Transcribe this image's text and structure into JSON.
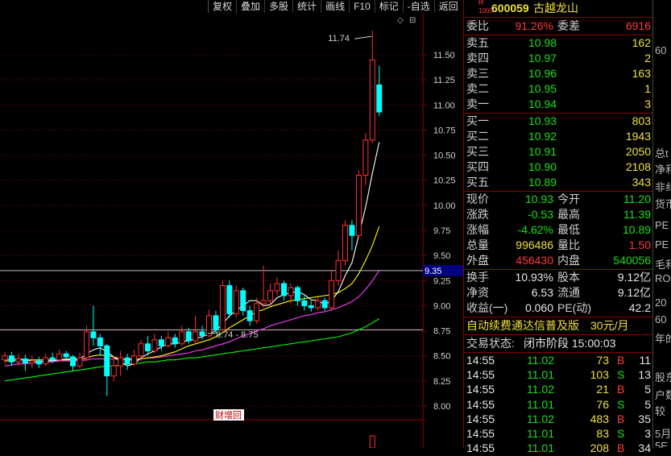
{
  "toolbar": [
    "复权",
    "叠加",
    "多股",
    "统计",
    "画线",
    "F10",
    "标记",
    "-自选",
    "返回"
  ],
  "stock": {
    "r_label": "R",
    "code_small": "1000",
    "code": "600059",
    "name": "古越龙山"
  },
  "weibi": {
    "label": "委比",
    "value": "91.26%",
    "diff_label": "委差",
    "diff": "6916"
  },
  "sells": [
    {
      "label": "卖五",
      "price": "10.98",
      "vol": "162"
    },
    {
      "label": "卖四",
      "price": "10.97",
      "vol": "2"
    },
    {
      "label": "卖三",
      "price": "10.96",
      "vol": "163"
    },
    {
      "label": "卖二",
      "price": "10.95",
      "vol": "1"
    },
    {
      "label": "卖一",
      "price": "10.94",
      "vol": "3"
    }
  ],
  "buys": [
    {
      "label": "买一",
      "price": "10.93",
      "vol": "803"
    },
    {
      "label": "买二",
      "price": "10.92",
      "vol": "1943"
    },
    {
      "label": "买三",
      "price": "10.91",
      "vol": "2050"
    },
    {
      "label": "买四",
      "price": "10.90",
      "vol": "2108"
    },
    {
      "label": "买五",
      "price": "10.89",
      "vol": "343"
    }
  ],
  "quote": [
    {
      "l1": "现价",
      "v1": "10.93",
      "c1": "grn",
      "l2": "今开",
      "v2": "11.20",
      "c2": "grn"
    },
    {
      "l1": "涨跌",
      "v1": "-0.53",
      "c1": "grn",
      "l2": "最高",
      "v2": "11.39",
      "c2": "grn"
    },
    {
      "l1": "涨幅",
      "v1": "-4.62%",
      "c1": "grn",
      "l2": "最低",
      "v2": "10.89",
      "c2": "grn"
    },
    {
      "l1": "总量",
      "v1": "996486",
      "c1": "yel",
      "l2": "量比",
      "v2": "1.50",
      "c2": "red"
    },
    {
      "l1": "外盘",
      "v1": "456430",
      "c1": "red",
      "l2": "内盘",
      "v2": "540056",
      "c2": "grn"
    }
  ],
  "fund": [
    {
      "l1": "换手",
      "v1": "10.93%",
      "l2": "股本",
      "v2": "9.12亿"
    },
    {
      "l1": "净资",
      "v1": "6.53",
      "l2": "流通",
      "v2": "9.12亿"
    },
    {
      "l1": "收益(一)",
      "v1": "0.060",
      "l2": "PE(动)",
      "v2": "42.2"
    }
  ],
  "ad": {
    "text": "自动续费通达信普及版",
    "price": "30元/月"
  },
  "trade_status": {
    "label": "交易状态:",
    "value": "闭市阶段 15:00:03"
  },
  "ticks": [
    {
      "time": "14:55",
      "price": "11.02",
      "vol": "73",
      "side": "B",
      "n": "11"
    },
    {
      "time": "14:55",
      "price": "11.01",
      "vol": "103",
      "side": "S",
      "n": "13"
    },
    {
      "time": "14:55",
      "price": "11.02",
      "vol": "21",
      "side": "B",
      "n": "5"
    },
    {
      "time": "14:55",
      "price": "11.01",
      "vol": "76",
      "side": "S",
      "n": "5"
    },
    {
      "time": "14:55",
      "price": "11.02",
      "vol": "483",
      "side": "B",
      "n": "35"
    },
    {
      "time": "14:55",
      "price": "11.01",
      "vol": "83",
      "side": "S",
      "n": "3"
    },
    {
      "time": "14:55",
      "price": "11.01",
      "vol": "208",
      "side": "B",
      "n": "34"
    }
  ],
  "edge_labels": [
    "60",
    "总t",
    "净利",
    "非纟",
    "货币",
    "PE",
    "PE",
    "毛利",
    "RO",
    "20",
    "60",
    "年的",
    "股东",
    "户数",
    "较",
    "5月",
    "5E"
  ],
  "chart_data": {
    "type": "candlestick",
    "y_ticks": [
      "11.50",
      "11.25",
      "11.00",
      "10.75",
      "10.50",
      "10.25",
      "10.00",
      "9.75",
      "9.50",
      "9.25",
      "9.00",
      "8.75",
      "8.50",
      "8.25",
      "8.00"
    ],
    "ylim": [
      7.85,
      11.95
    ],
    "current_price_tag": "9.35",
    "current_price_value": 9.35,
    "ref_line_value": 8.76,
    "high_annotation": "11.74",
    "high_value": 11.74,
    "range_annotation": "8.74 - 8.75",
    "range_value": 8.74,
    "event_marker": "财增回",
    "colors": {
      "up": "#ff3030",
      "down": "#00ffff",
      "ma5": "#ffffff",
      "ma10": "#ffff00",
      "ma20": "#ff40ff",
      "ma60": "#00ff00"
    },
    "candles": [
      {
        "o": 8.46,
        "c": 8.5,
        "h": 8.54,
        "l": 8.42
      },
      {
        "o": 8.5,
        "c": 8.44,
        "h": 8.54,
        "l": 8.4
      },
      {
        "o": 8.44,
        "c": 8.47,
        "h": 8.52,
        "l": 8.4
      },
      {
        "o": 8.47,
        "c": 8.43,
        "h": 8.51,
        "l": 8.35
      },
      {
        "o": 8.43,
        "c": 8.45,
        "h": 8.5,
        "l": 8.38
      },
      {
        "o": 8.45,
        "c": 8.42,
        "h": 8.49,
        "l": 8.38
      },
      {
        "o": 8.42,
        "c": 8.48,
        "h": 8.52,
        "l": 8.4
      },
      {
        "o": 8.48,
        "c": 8.46,
        "h": 8.53,
        "l": 8.43
      },
      {
        "o": 8.46,
        "c": 8.52,
        "h": 8.56,
        "l": 8.44
      },
      {
        "o": 8.52,
        "c": 8.49,
        "h": 8.55,
        "l": 8.45
      },
      {
        "o": 8.49,
        "c": 8.4,
        "h": 8.51,
        "l": 8.35
      },
      {
        "o": 8.4,
        "c": 8.48,
        "h": 8.53,
        "l": 8.38
      },
      {
        "o": 8.48,
        "c": 8.74,
        "h": 8.8,
        "l": 8.45
      },
      {
        "o": 8.74,
        "c": 8.68,
        "h": 9.0,
        "l": 8.6
      },
      {
        "o": 8.68,
        "c": 8.6,
        "h": 8.72,
        "l": 8.5
      },
      {
        "o": 8.6,
        "c": 8.3,
        "h": 8.62,
        "l": 8.1
      },
      {
        "o": 8.3,
        "c": 8.4,
        "h": 8.5,
        "l": 8.25
      },
      {
        "o": 8.4,
        "c": 8.48,
        "h": 8.55,
        "l": 8.3
      },
      {
        "o": 8.48,
        "c": 8.42,
        "h": 8.52,
        "l": 8.36
      },
      {
        "o": 8.42,
        "c": 8.5,
        "h": 8.56,
        "l": 8.4
      },
      {
        "o": 8.5,
        "c": 8.62,
        "h": 8.66,
        "l": 8.45
      },
      {
        "o": 8.62,
        "c": 8.55,
        "h": 8.7,
        "l": 8.5
      },
      {
        "o": 8.55,
        "c": 8.66,
        "h": 8.72,
        "l": 8.52
      },
      {
        "o": 8.66,
        "c": 8.6,
        "h": 8.7,
        "l": 8.55
      },
      {
        "o": 8.6,
        "c": 8.68,
        "h": 8.74,
        "l": 8.58
      },
      {
        "o": 8.68,
        "c": 8.62,
        "h": 8.72,
        "l": 8.58
      },
      {
        "o": 8.62,
        "c": 8.74,
        "h": 8.8,
        "l": 8.6
      },
      {
        "o": 8.74,
        "c": 8.65,
        "h": 8.78,
        "l": 8.62
      },
      {
        "o": 8.65,
        "c": 8.74,
        "h": 8.9,
        "l": 8.62
      },
      {
        "o": 8.74,
        "c": 8.7,
        "h": 8.8,
        "l": 8.66
      },
      {
        "o": 8.7,
        "c": 8.9,
        "h": 8.96,
        "l": 8.68
      },
      {
        "o": 8.9,
        "c": 8.76,
        "h": 8.95,
        "l": 8.72
      },
      {
        "o": 8.76,
        "c": 9.2,
        "h": 9.25,
        "l": 8.74
      },
      {
        "o": 9.2,
        "c": 8.92,
        "h": 9.25,
        "l": 8.88
      },
      {
        "o": 8.92,
        "c": 9.15,
        "h": 9.2,
        "l": 8.88
      },
      {
        "o": 9.15,
        "c": 8.95,
        "h": 9.18,
        "l": 8.9
      },
      {
        "o": 8.95,
        "c": 8.85,
        "h": 9.0,
        "l": 8.8
      },
      {
        "o": 8.85,
        "c": 9.02,
        "h": 9.08,
        "l": 8.82
      },
      {
        "o": 9.02,
        "c": 9.05,
        "h": 9.4,
        "l": 8.98
      },
      {
        "o": 9.05,
        "c": 9.15,
        "h": 9.22,
        "l": 9.0
      },
      {
        "o": 9.15,
        "c": 9.22,
        "h": 9.28,
        "l": 9.1
      },
      {
        "o": 9.22,
        "c": 9.1,
        "h": 9.25,
        "l": 9.05
      },
      {
        "o": 9.1,
        "c": 9.18,
        "h": 9.22,
        "l": 9.02
      },
      {
        "o": 9.18,
        "c": 9.05,
        "h": 9.2,
        "l": 9.0
      },
      {
        "o": 9.05,
        "c": 9.0,
        "h": 9.1,
        "l": 8.95
      },
      {
        "o": 9.0,
        "c": 8.98,
        "h": 9.05,
        "l": 8.94
      },
      {
        "o": 8.98,
        "c": 9.05,
        "h": 9.08,
        "l": 8.95
      },
      {
        "o": 9.05,
        "c": 8.98,
        "h": 9.08,
        "l": 8.95
      },
      {
        "o": 8.98,
        "c": 9.25,
        "h": 9.35,
        "l": 8.95
      },
      {
        "o": 9.25,
        "c": 9.45,
        "h": 9.55,
        "l": 9.2
      },
      {
        "o": 9.45,
        "c": 9.8,
        "h": 9.85,
        "l": 9.4
      },
      {
        "o": 9.8,
        "c": 9.7,
        "h": 9.85,
        "l": 9.55
      },
      {
        "o": 9.7,
        "c": 10.3,
        "h": 10.35,
        "l": 9.68
      },
      {
        "o": 10.3,
        "c": 10.65,
        "h": 10.72,
        "l": 10.2
      },
      {
        "o": 10.65,
        "c": 11.45,
        "h": 11.74,
        "l": 10.62
      },
      {
        "o": 11.2,
        "c": 10.93,
        "h": 11.39,
        "l": 10.89
      }
    ],
    "ma5": [
      8.46,
      8.47,
      8.47,
      8.46,
      8.45,
      8.44,
      8.45,
      8.45,
      8.46,
      8.47,
      8.47,
      8.47,
      8.52,
      8.56,
      8.58,
      8.54,
      8.49,
      8.44,
      8.4,
      8.42,
      8.48,
      8.52,
      8.55,
      8.59,
      8.62,
      8.62,
      8.64,
      8.65,
      8.67,
      8.69,
      8.72,
      8.75,
      8.82,
      8.9,
      8.95,
      9.0,
      9.05,
      9.05,
      9.0,
      9.01,
      9.08,
      9.11,
      9.13,
      9.14,
      9.11,
      9.06,
      9.05,
      9.01,
      9.05,
      9.14,
      9.3,
      9.43,
      9.7,
      9.98,
      10.32,
      10.63
    ],
    "ma10": [
      8.45,
      8.45,
      8.46,
      8.46,
      8.46,
      8.46,
      8.46,
      8.46,
      8.46,
      8.46,
      8.46,
      8.46,
      8.48,
      8.5,
      8.51,
      8.5,
      8.49,
      8.47,
      8.46,
      8.46,
      8.47,
      8.48,
      8.49,
      8.5,
      8.52,
      8.54,
      8.57,
      8.6,
      8.62,
      8.64,
      8.66,
      8.69,
      8.73,
      8.78,
      8.82,
      8.86,
      8.9,
      8.94,
      8.96,
      8.99,
      9.01,
      9.03,
      9.05,
      9.06,
      9.07,
      9.08,
      9.09,
      9.1,
      9.11,
      9.13,
      9.17,
      9.22,
      9.32,
      9.45,
      9.6,
      9.79
    ],
    "ma20": [
      8.4,
      8.41,
      8.42,
      8.42,
      8.43,
      8.43,
      8.44,
      8.44,
      8.45,
      8.45,
      8.45,
      8.45,
      8.46,
      8.47,
      8.47,
      8.47,
      8.47,
      8.47,
      8.47,
      8.47,
      8.47,
      8.48,
      8.48,
      8.49,
      8.5,
      8.51,
      8.52,
      8.53,
      8.55,
      8.56,
      8.58,
      8.6,
      8.62,
      8.64,
      8.67,
      8.7,
      8.72,
      8.75,
      8.77,
      8.8,
      8.82,
      8.84,
      8.86,
      8.88,
      8.9,
      8.91,
      8.93,
      8.94,
      8.96,
      8.98,
      9.01,
      9.04,
      9.09,
      9.16,
      9.25,
      9.35
    ],
    "ma60": [
      8.25,
      8.26,
      8.27,
      8.28,
      8.29,
      8.3,
      8.31,
      8.32,
      8.33,
      8.34,
      8.35,
      8.36,
      8.37,
      8.38,
      8.39,
      8.4,
      8.4,
      8.41,
      8.42,
      8.42,
      8.43,
      8.44,
      8.44,
      8.45,
      8.46,
      8.46,
      8.47,
      8.48,
      8.48,
      8.49,
      8.5,
      8.51,
      8.52,
      8.53,
      8.54,
      8.55,
      8.56,
      8.57,
      8.58,
      8.59,
      8.6,
      8.61,
      8.62,
      8.63,
      8.64,
      8.65,
      8.66,
      8.67,
      8.68,
      8.69,
      8.71,
      8.73,
      8.76,
      8.79,
      8.83,
      8.87
    ]
  }
}
